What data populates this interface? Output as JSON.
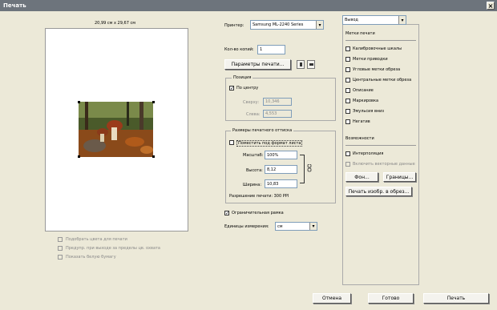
{
  "window": {
    "title": "Печать",
    "close": "×"
  },
  "preview": {
    "paper_size": "20,99 см x 29,67 см"
  },
  "printer": {
    "label": "Принтер:",
    "value": "Samsung ML-2240 Series"
  },
  "copies": {
    "label": "Кол-во копий:",
    "value": "1"
  },
  "page_setup_button": "Параметры печати...",
  "position": {
    "legend": "Позиция",
    "center_label": "По центру",
    "center_checked": "✓",
    "top_label": "Сверху:",
    "top_value": "10,346",
    "left_label": "Слева:",
    "left_value": "4,553"
  },
  "scaled_print_size": {
    "legend": "Размеры печатного оттиска",
    "fit_label": "Поместить под формат листа",
    "scale_label": "Масштаб:",
    "scale_value": "100%",
    "height_label": "Высота:",
    "height_value": "8,12",
    "width_label": "Ширина:",
    "width_value": "10,83",
    "resolution": "Разрешение печати: 300 PPI"
  },
  "bounding_box": {
    "label": "Ограничительная рамка",
    "checked": "✓"
  },
  "units": {
    "label": "Единицы измерения:",
    "value": "см"
  },
  "color_options": [
    "Подобрать цвета для печати",
    "Предупр. при выходе за пределы цв. охвата",
    "Показать белую бумагу"
  ],
  "output": {
    "dropdown": "Вывод",
    "marks_title": "Метки печати",
    "marks": [
      "Калибровочные шкалы",
      "Метки приводки",
      "Угловые метки обреза",
      "Центральные метки обреза",
      "Описание",
      "Маркировка",
      "Эмульсия вниз",
      "Негатив"
    ],
    "functions_title": "Возможности",
    "interpolation": "Интерполяция",
    "vector_data": "Включить векторные данные",
    "background_button": "Фон...",
    "border_button": "Границы...",
    "bleed_button": "Печать изобр. в обрез..."
  },
  "footer": {
    "cancel": "Отмена",
    "done": "Готово",
    "print": "Печать"
  }
}
